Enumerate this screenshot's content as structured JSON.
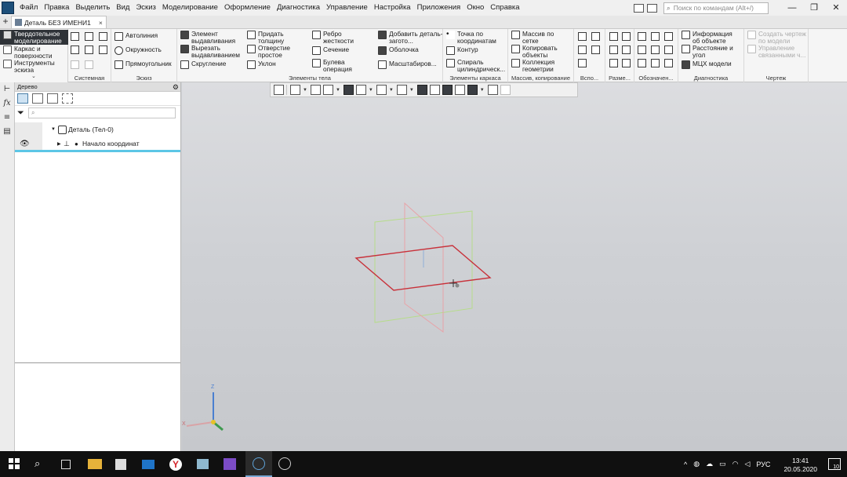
{
  "menu": {
    "items": [
      "Файл",
      "Правка",
      "Выделить",
      "Вид",
      "Эскиз",
      "Моделирование",
      "Оформление",
      "Диагностика",
      "Управление",
      "Настройка",
      "Приложения",
      "Окно",
      "Справка"
    ],
    "search_placeholder": "Поиск по командам (Alt+/)",
    "win_min": "—",
    "win_max": "❐",
    "win_close": "✕"
  },
  "tabs": {
    "doc_tab": "Деталь БЕЗ ИМЕНИ1",
    "plus": "+",
    "close": "×"
  },
  "modes": [
    {
      "label": "Твердотельное моделирование",
      "active": true
    },
    {
      "label": "Каркас и поверхности",
      "active": false
    },
    {
      "label": "Инструменты эскиза",
      "active": false
    }
  ],
  "ribbon": {
    "sketch": {
      "autoline": "Автолиния",
      "circle": "Окружность",
      "rect": "Прямоугольник"
    },
    "body": {
      "extrude": "Элемент выдавливания",
      "cut_extrude": "Вырезать выдавливанием",
      "fillet": "Скругление",
      "thicken": "Придать толщину",
      "hole": "Отверстие простое",
      "draft": "Уклон",
      "rib": "Ребро жесткости",
      "section": "Сечение",
      "boolean": "Булева операция",
      "add_part": "Добавить деталь-загото...",
      "shell": "Оболочка",
      "scale": "Масштабиров..."
    },
    "frame": {
      "point": "Точка по координатам",
      "contour": "Контур",
      "spiral": "Спираль цилиндрическ..."
    },
    "array": {
      "grid": "Массив по сетке",
      "copy": "Копировать объекты",
      "collection": "Коллекция геометрии"
    },
    "diag": {
      "info": "Информация об объекте",
      "distance": "Расстояние и угол",
      "mass": "МЦХ модели"
    },
    "drawing": {
      "create": "Создать чертеж по модели",
      "manage": "Управление связанными ч..."
    },
    "group_labels": {
      "system": "Системная",
      "sketch": "Эскиз",
      "body": "Элементы тела",
      "frame": "Элементы каркаса",
      "array": "Массив, копирование",
      "aux": "Вспо...",
      "dims": "Разме...",
      "designations": "Обозначен...",
      "diag": "Диагностика",
      "drawing": "Чертеж"
    }
  },
  "tree": {
    "header": "Дерево",
    "filter_placeholder": "⌕",
    "root": "Деталь (Тел-0)",
    "origin": "Начало координат"
  },
  "axes": {
    "z": "Z",
    "x": "X"
  },
  "taskbar": {
    "lang": "РУС",
    "time": "13:41",
    "date": "20.05.2020",
    "notif_count": "10"
  },
  "colors": {
    "plane_red": "#c8313a",
    "plane_green": "#b6dc8a",
    "plane_pink": "#e8a3a8",
    "active_mode": "#2f3338",
    "selection": "#5cc6e6"
  }
}
